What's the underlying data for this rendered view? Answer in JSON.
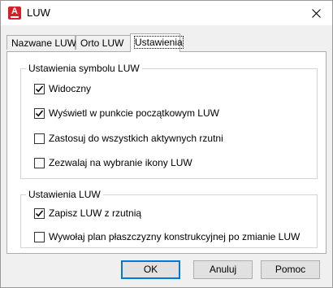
{
  "window": {
    "title": "LUW",
    "app_icon_letter": "A",
    "close_symbol": "✕"
  },
  "tabs": [
    {
      "label": "Nazwane LUW",
      "active": false
    },
    {
      "label": "Orto LUW",
      "active": false
    },
    {
      "label": "Ustawienia",
      "active": true
    }
  ],
  "symbol_settings": {
    "legend": "Ustawienia symbolu LUW",
    "options": [
      {
        "label": "Widoczny",
        "checked": true
      },
      {
        "label": "Wyświetl w punkcie początkowym LUW",
        "checked": true
      },
      {
        "label": "Zastosuj do wszystkich aktywnych rzutni",
        "checked": false
      },
      {
        "label": "Zezwalaj na wybranie ikony LUW",
        "checked": false
      }
    ]
  },
  "ucs_settings": {
    "legend": "Ustawienia LUW",
    "options": [
      {
        "label": "Zapisz LUW z rzutnią",
        "checked": true
      },
      {
        "label": "Wywołaj plan płaszczyzny konstrukcyjnej po zmianie LUW",
        "checked": false
      }
    ]
  },
  "buttons": {
    "ok": "OK",
    "cancel": "Anuluj",
    "help": "Pomoc"
  },
  "colors": {
    "app_icon": "#d81e27",
    "default_button_border": "#0078d7"
  }
}
